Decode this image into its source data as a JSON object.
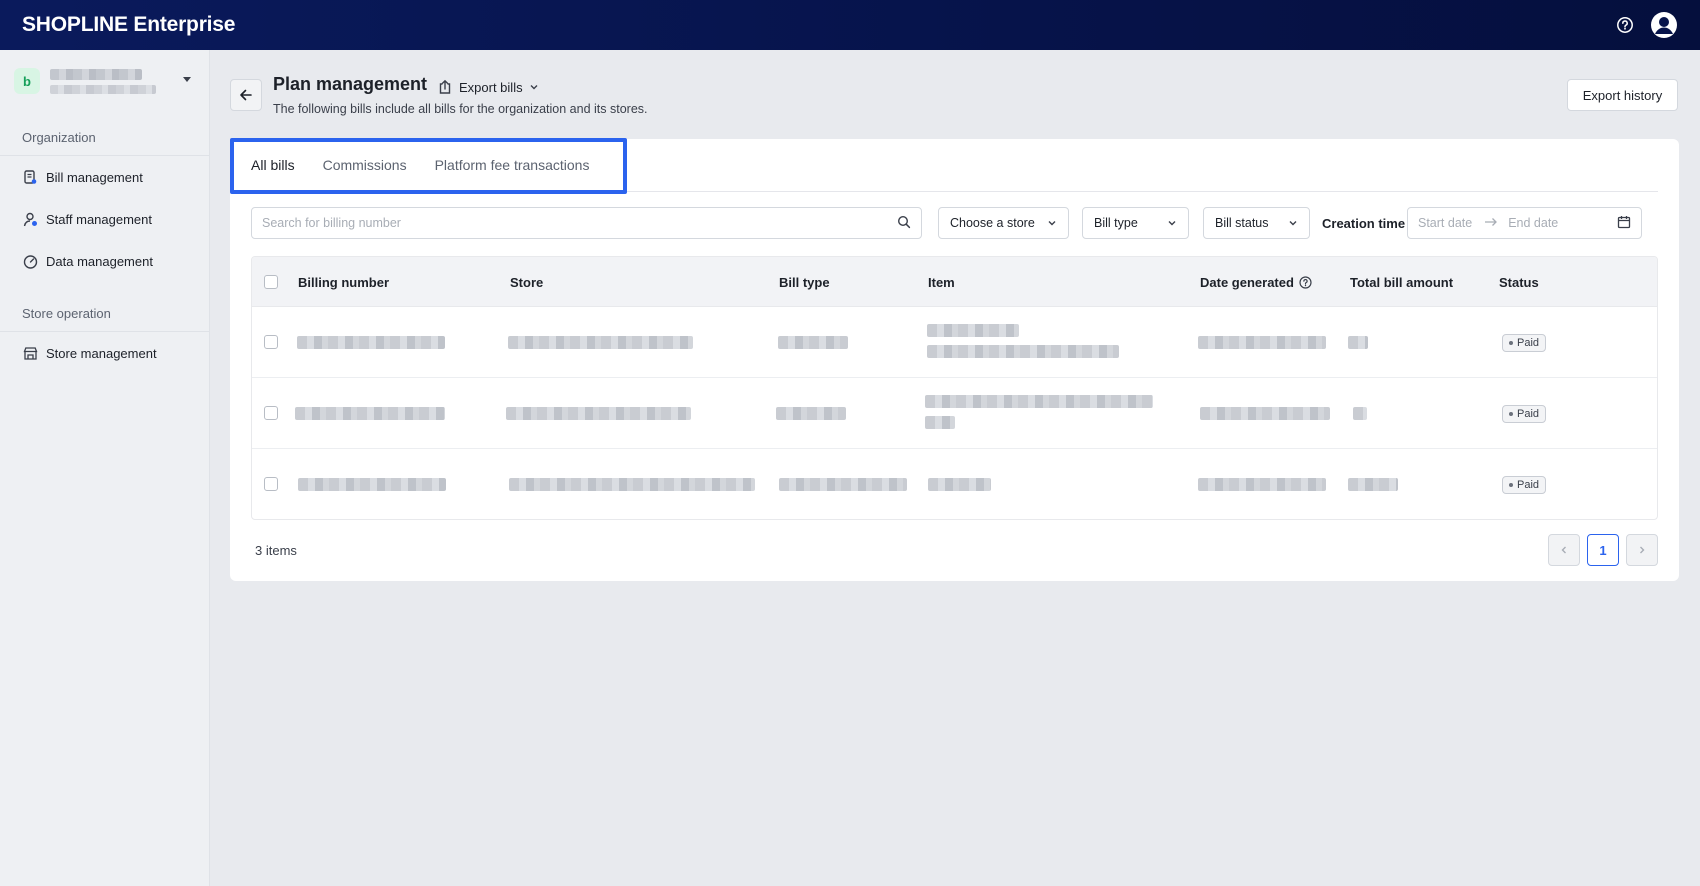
{
  "app": {
    "logo": "SHOPLINE Enterprise"
  },
  "sidebar": {
    "org_initial": "b",
    "sections": [
      {
        "label": "Organization",
        "items": [
          {
            "label": "Bill management",
            "icon": "bill-icon"
          },
          {
            "label": "Staff management",
            "icon": "staff-icon"
          },
          {
            "label": "Data management",
            "icon": "gauge-icon"
          }
        ]
      },
      {
        "label": "Store operation",
        "items": [
          {
            "label": "Store management",
            "icon": "store-icon"
          }
        ]
      }
    ]
  },
  "header": {
    "title": "Plan management",
    "export_bills": "Export bills",
    "subtitle": "The following bills include all bills for the organization and its stores.",
    "export_history": "Export history"
  },
  "tabs": [
    {
      "label": "All bills",
      "active": true
    },
    {
      "label": "Commissions",
      "active": false
    },
    {
      "label": "Platform fee transactions",
      "active": false
    }
  ],
  "filters": {
    "search_placeholder": "Search for billing number",
    "store_select": "Choose a store",
    "bill_type_select": "Bill type",
    "bill_status_select": "Bill status",
    "creation_time_label": "Creation time",
    "start_date_placeholder": "Start date",
    "end_date_placeholder": "End date"
  },
  "table": {
    "columns": [
      "Billing number",
      "Store",
      "Bill type",
      "Item",
      "Date generated",
      "Total bill amount",
      "Status"
    ],
    "rows": [
      {
        "status": "Paid"
      },
      {
        "status": "Paid"
      },
      {
        "status": "Paid"
      }
    ]
  },
  "footer": {
    "items_count": "3 items",
    "current_page": "1"
  },
  "colors": {
    "topbar": "#06134a",
    "accent": "#2b63ee",
    "highlight": "#2b63ee"
  }
}
